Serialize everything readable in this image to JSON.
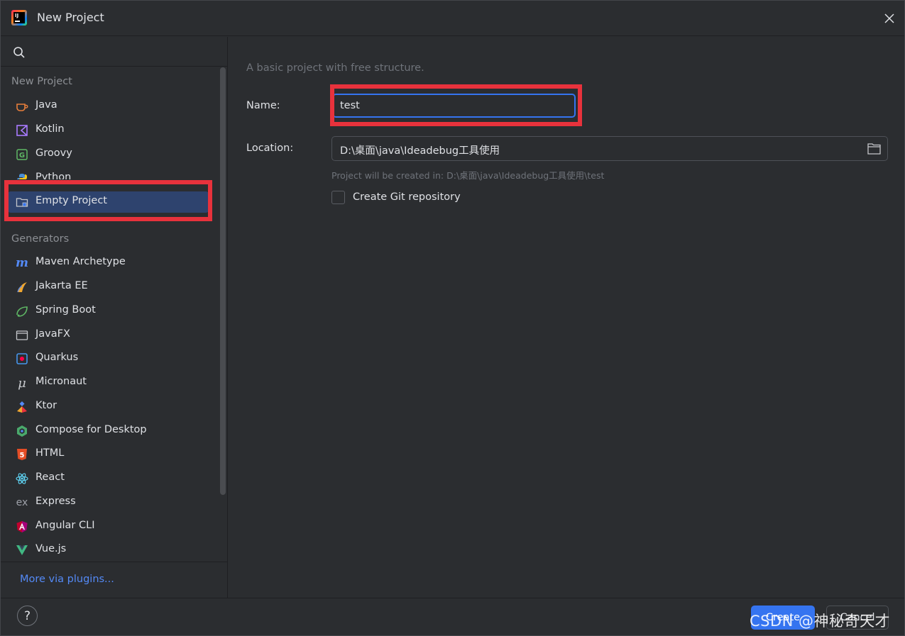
{
  "window": {
    "title": "New Project"
  },
  "search": {
    "placeholder": "",
    "value": ""
  },
  "sidebar": {
    "new_project_label": "New Project",
    "generators_label": "Generators",
    "new_project_items": [
      {
        "label": "Java",
        "icon": "java-cup-icon"
      },
      {
        "label": "Kotlin",
        "icon": "kotlin-icon"
      },
      {
        "label": "Groovy",
        "icon": "groovy-icon"
      },
      {
        "label": "Python",
        "icon": "python-icon"
      },
      {
        "label": "Empty Project",
        "icon": "folder-icon",
        "selected": true
      }
    ],
    "generator_items": [
      {
        "label": "Maven Archetype",
        "icon": "maven-icon"
      },
      {
        "label": "Jakarta EE",
        "icon": "jakarta-ee-icon"
      },
      {
        "label": "Spring Boot",
        "icon": "spring-boot-icon"
      },
      {
        "label": "JavaFX",
        "icon": "javafx-icon"
      },
      {
        "label": "Quarkus",
        "icon": "quarkus-icon"
      },
      {
        "label": "Micronaut",
        "icon": "micronaut-icon"
      },
      {
        "label": "Ktor",
        "icon": "ktor-icon"
      },
      {
        "label": "Compose for Desktop",
        "icon": "compose-icon"
      },
      {
        "label": "HTML",
        "icon": "html5-icon"
      },
      {
        "label": "React",
        "icon": "react-icon"
      },
      {
        "label": "Express",
        "icon": "express-icon"
      },
      {
        "label": "Angular CLI",
        "icon": "angular-icon"
      },
      {
        "label": "Vue.js",
        "icon": "vue-icon"
      }
    ],
    "more_plugins": "More via plugins..."
  },
  "form": {
    "description": "A basic project with free structure.",
    "name_label": "Name:",
    "name_value": "test",
    "location_label": "Location:",
    "location_value": "D:\\桌面\\java\\Ideadebug工具使用",
    "location_hint": "Project will be created in: D:\\桌面\\java\\Ideadebug工具使用\\test",
    "git_label": "Create Git repository",
    "git_checked": false
  },
  "footer": {
    "help": "?",
    "create_label": "Create",
    "cancel_label": "Cancel",
    "watermark": "CSDN @神秘奇天才"
  },
  "colors": {
    "accent": "#3574f0",
    "selected_bg": "#2e436e",
    "highlight_red": "#e8323c",
    "link": "#548af7"
  }
}
